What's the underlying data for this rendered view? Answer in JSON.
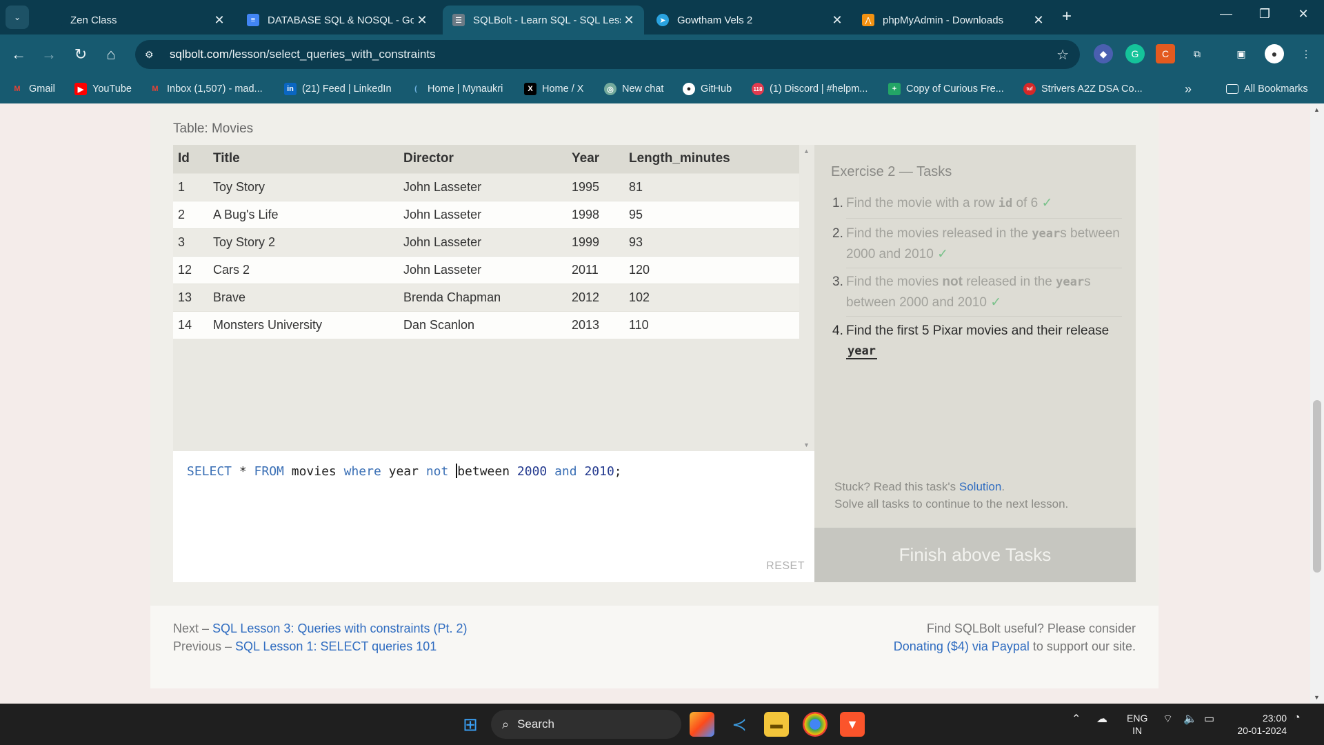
{
  "browser": {
    "tabs": [
      {
        "title": "Zen Class",
        "icon": "zen-icon",
        "active": false
      },
      {
        "title": "DATABASE SQL & NOSQL - Goo",
        "icon": "google-docs-icon",
        "active": false
      },
      {
        "title": "SQLBolt - Learn SQL - SQL Less",
        "icon": "sqlbolt-icon",
        "active": true
      },
      {
        "title": "Gowtham Vels 2",
        "icon": "telegram-icon",
        "active": false
      },
      {
        "title": "phpMyAdmin - Downloads",
        "icon": "phpmyadmin-icon",
        "active": false
      }
    ],
    "address": {
      "domain": "sqlbolt.com",
      "path": "/lesson/select_queries_with_constraints"
    },
    "bookmarks": [
      {
        "label": "Gmail",
        "icon": "gmail-icon",
        "color": "#ea4335",
        "glyph": "M"
      },
      {
        "label": "YouTube",
        "icon": "youtube-icon",
        "color": "#ff0000",
        "glyph": "▶"
      },
      {
        "label": "Inbox (1,507) - mad...",
        "icon": "gmail-icon",
        "color": "#ea4335",
        "glyph": "M"
      },
      {
        "label": "(21) Feed | LinkedIn",
        "icon": "linkedin-icon",
        "color": "#0a66c2",
        "glyph": "in"
      },
      {
        "label": "Home | Mynaukri",
        "icon": "mynaukri-icon",
        "color": "#2b7bb9",
        "glyph": "("
      },
      {
        "label": "Home / X",
        "icon": "x-icon",
        "color": "#000000",
        "glyph": "X"
      },
      {
        "label": "New chat",
        "icon": "chatgpt-icon",
        "color": "#74aa9c",
        "glyph": "◎"
      },
      {
        "label": "GitHub",
        "icon": "github-icon",
        "color": "#222222",
        "glyph": "●"
      },
      {
        "label": "(1) Discord | #helpm...",
        "icon": "discord-icon",
        "color": "#e23b4f",
        "glyph": "118"
      },
      {
        "label": "Copy of Curious Fre...",
        "icon": "sheets-icon",
        "color": "#23a566",
        "glyph": "+"
      },
      {
        "label": "Strivers A2Z DSA Co...",
        "icon": "tuf-icon",
        "color": "#d62828",
        "glyph": "tuf"
      }
    ],
    "all_bookmarks": "All Bookmarks"
  },
  "lesson": {
    "table_caption": "Table: Movies",
    "columns": [
      "Id",
      "Title",
      "Director",
      "Year",
      "Length_minutes"
    ],
    "rows": [
      [
        "1",
        "Toy Story",
        "John Lasseter",
        "1995",
        "81"
      ],
      [
        "2",
        "A Bug's Life",
        "John Lasseter",
        "1998",
        "95"
      ],
      [
        "3",
        "Toy Story 2",
        "John Lasseter",
        "1999",
        "93"
      ],
      [
        "12",
        "Cars 2",
        "John Lasseter",
        "2011",
        "120"
      ],
      [
        "13",
        "Brave",
        "Brenda Chapman",
        "2012",
        "102"
      ],
      [
        "14",
        "Monsters University",
        "Dan Scanlon",
        "2013",
        "110"
      ]
    ],
    "query": {
      "select": "SELECT",
      "star": " * ",
      "from": "FROM",
      "table": " movies ",
      "where": "where",
      "col": " year ",
      "not": "not",
      "between_a": "b",
      "between_b": "etween ",
      "n1": "2000",
      "and": " and ",
      "n2": "2010",
      "end": ";"
    },
    "reset": "RESET",
    "tasks_title": "Exercise 2 — Tasks",
    "tasks": [
      {
        "num": "1.",
        "pre": "Find the movie with a row ",
        "code": "id",
        "post": " of 6",
        "check": "✓"
      },
      {
        "num": "2.",
        "pre": "Find the movies released in the ",
        "code": "year",
        "post": "s between 2000 and 2010",
        "check": "✓"
      },
      {
        "num": "3.",
        "pre": "Find the movies ",
        "bold": "not",
        "mid": " released in the ",
        "code": "year",
        "post": "s between 2000 and 2010",
        "check": "✓"
      },
      {
        "num": "4.",
        "pre": "Find the first 5 Pixar movies and their release ",
        "code": "year"
      }
    ],
    "stuck_text": "Stuck? Read this task's ",
    "solution_link": "Solution",
    "stuck_tail": ".",
    "solve_all": "Solve all tasks to continue to the next lesson.",
    "finish_button": "Finish above Tasks",
    "next_prefix": "Next – ",
    "next_link": "SQL Lesson 3: Queries with constraints (Pt. 2)",
    "prev_prefix": "Previous – ",
    "prev_link": "SQL Lesson 1: SELECT queries 101",
    "useful_text": "Find SQLBolt useful? Please consider",
    "donate_link": "Donating ($4) via Paypal",
    "donate_tail": " to support our site."
  },
  "taskbar": {
    "search": "Search",
    "lang": "ENG",
    "region": "IN",
    "time": "23:00",
    "date": "20-01-2024"
  },
  "colors": {
    "browser_frame": "#0b3b4e",
    "toolbar": "#175a70",
    "link": "#2f6cc0",
    "check": "#7bc28c"
  }
}
